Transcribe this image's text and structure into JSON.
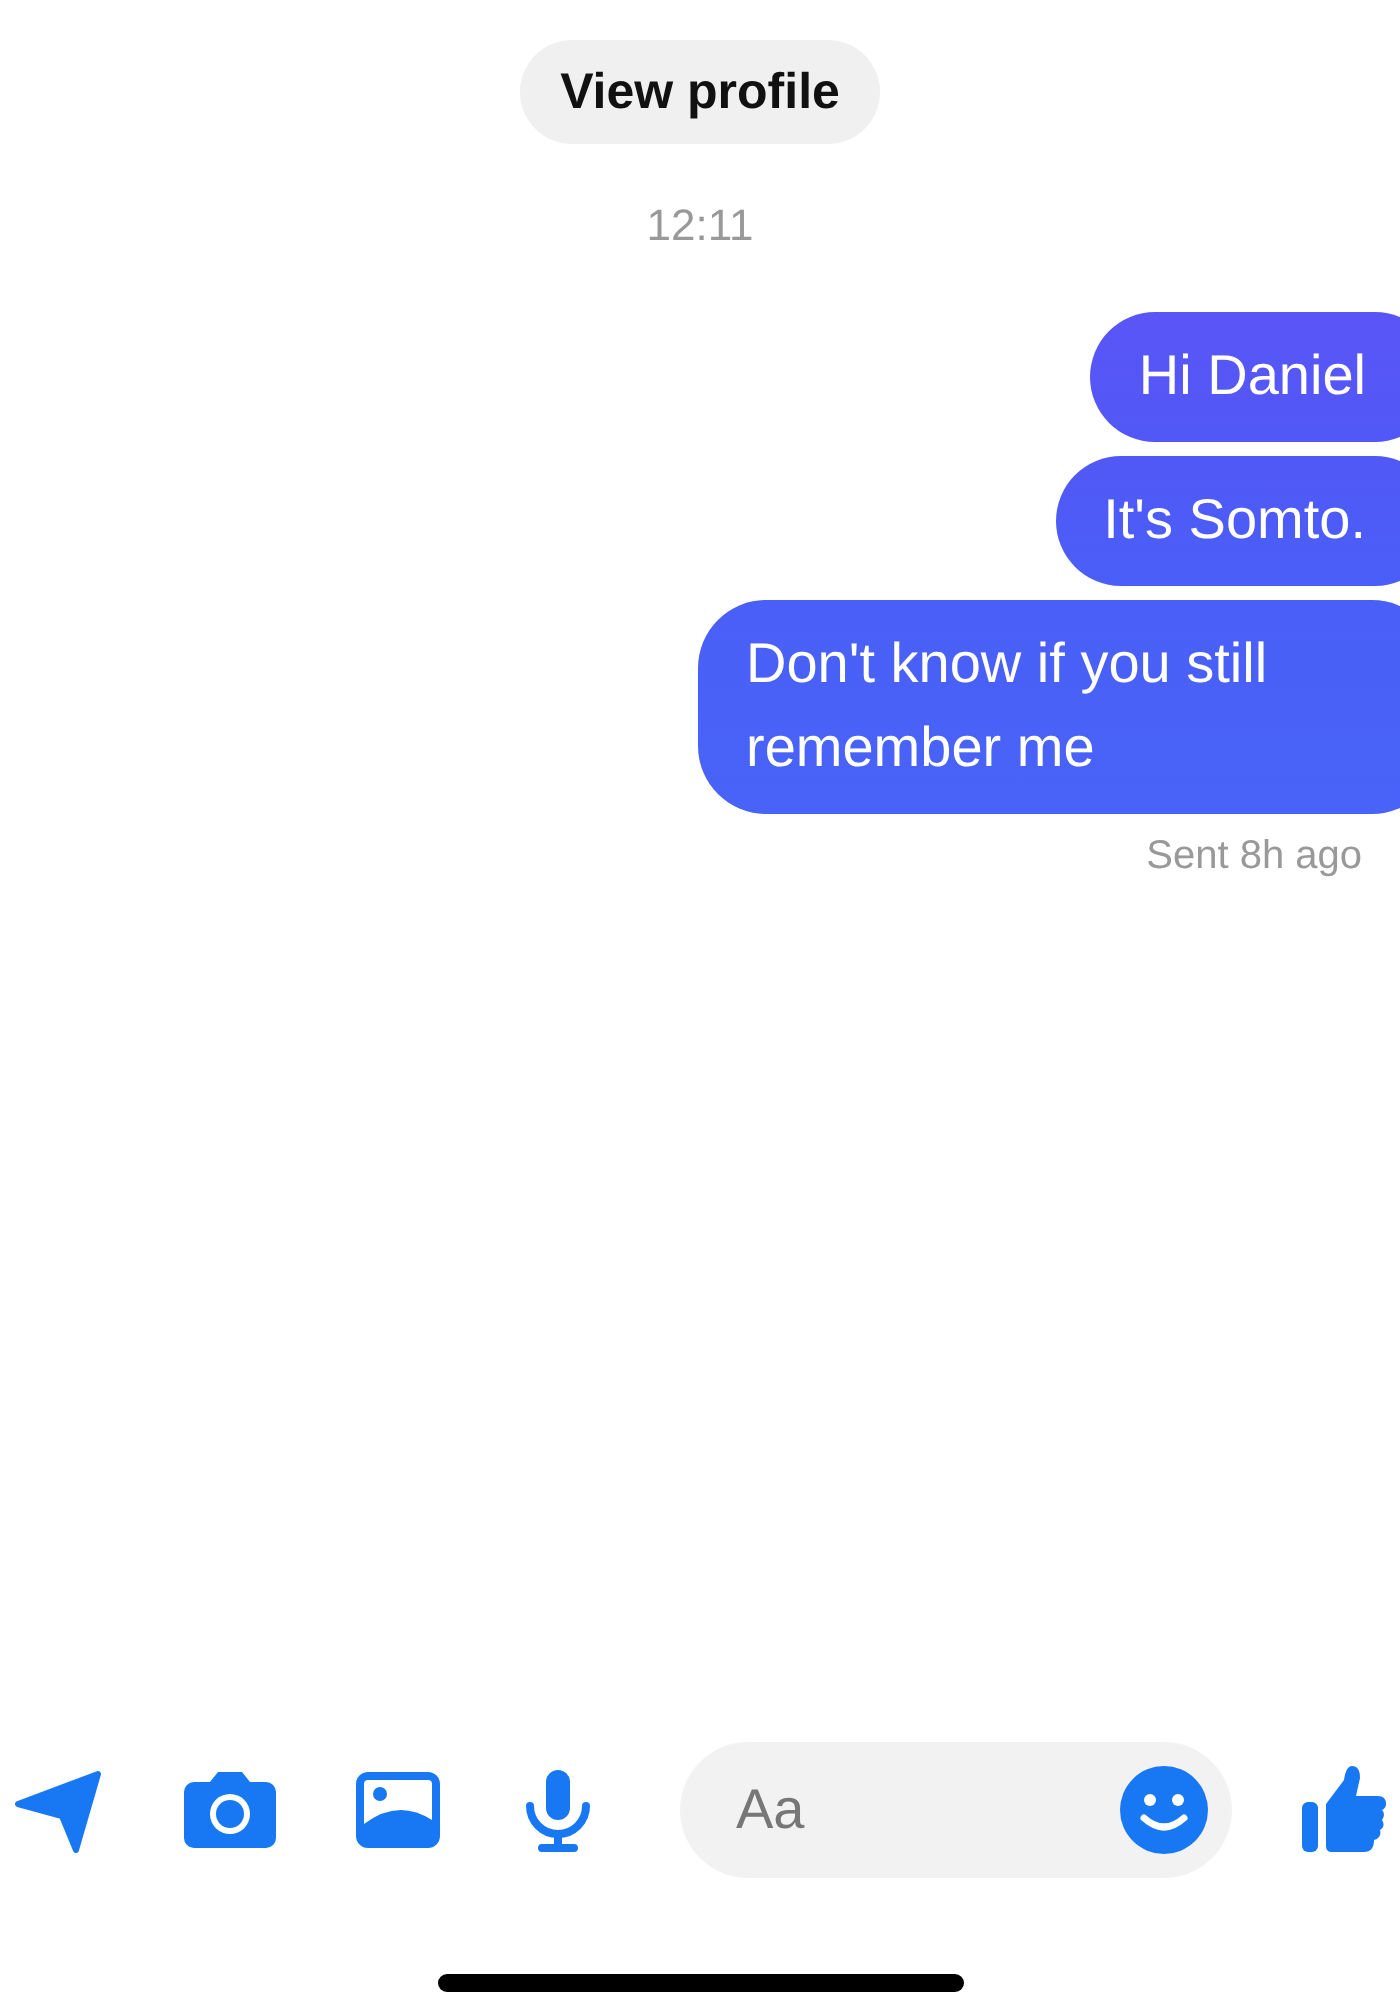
{
  "header": {
    "profile_button": "View profile",
    "timestamp": "12:11"
  },
  "messages": [
    {
      "text": "Hi Daniel"
    },
    {
      "text": "It's Somto."
    },
    {
      "text": "Don't know if you still remember me"
    }
  ],
  "status": "Sent 8h ago",
  "composer": {
    "placeholder": "Aa"
  }
}
